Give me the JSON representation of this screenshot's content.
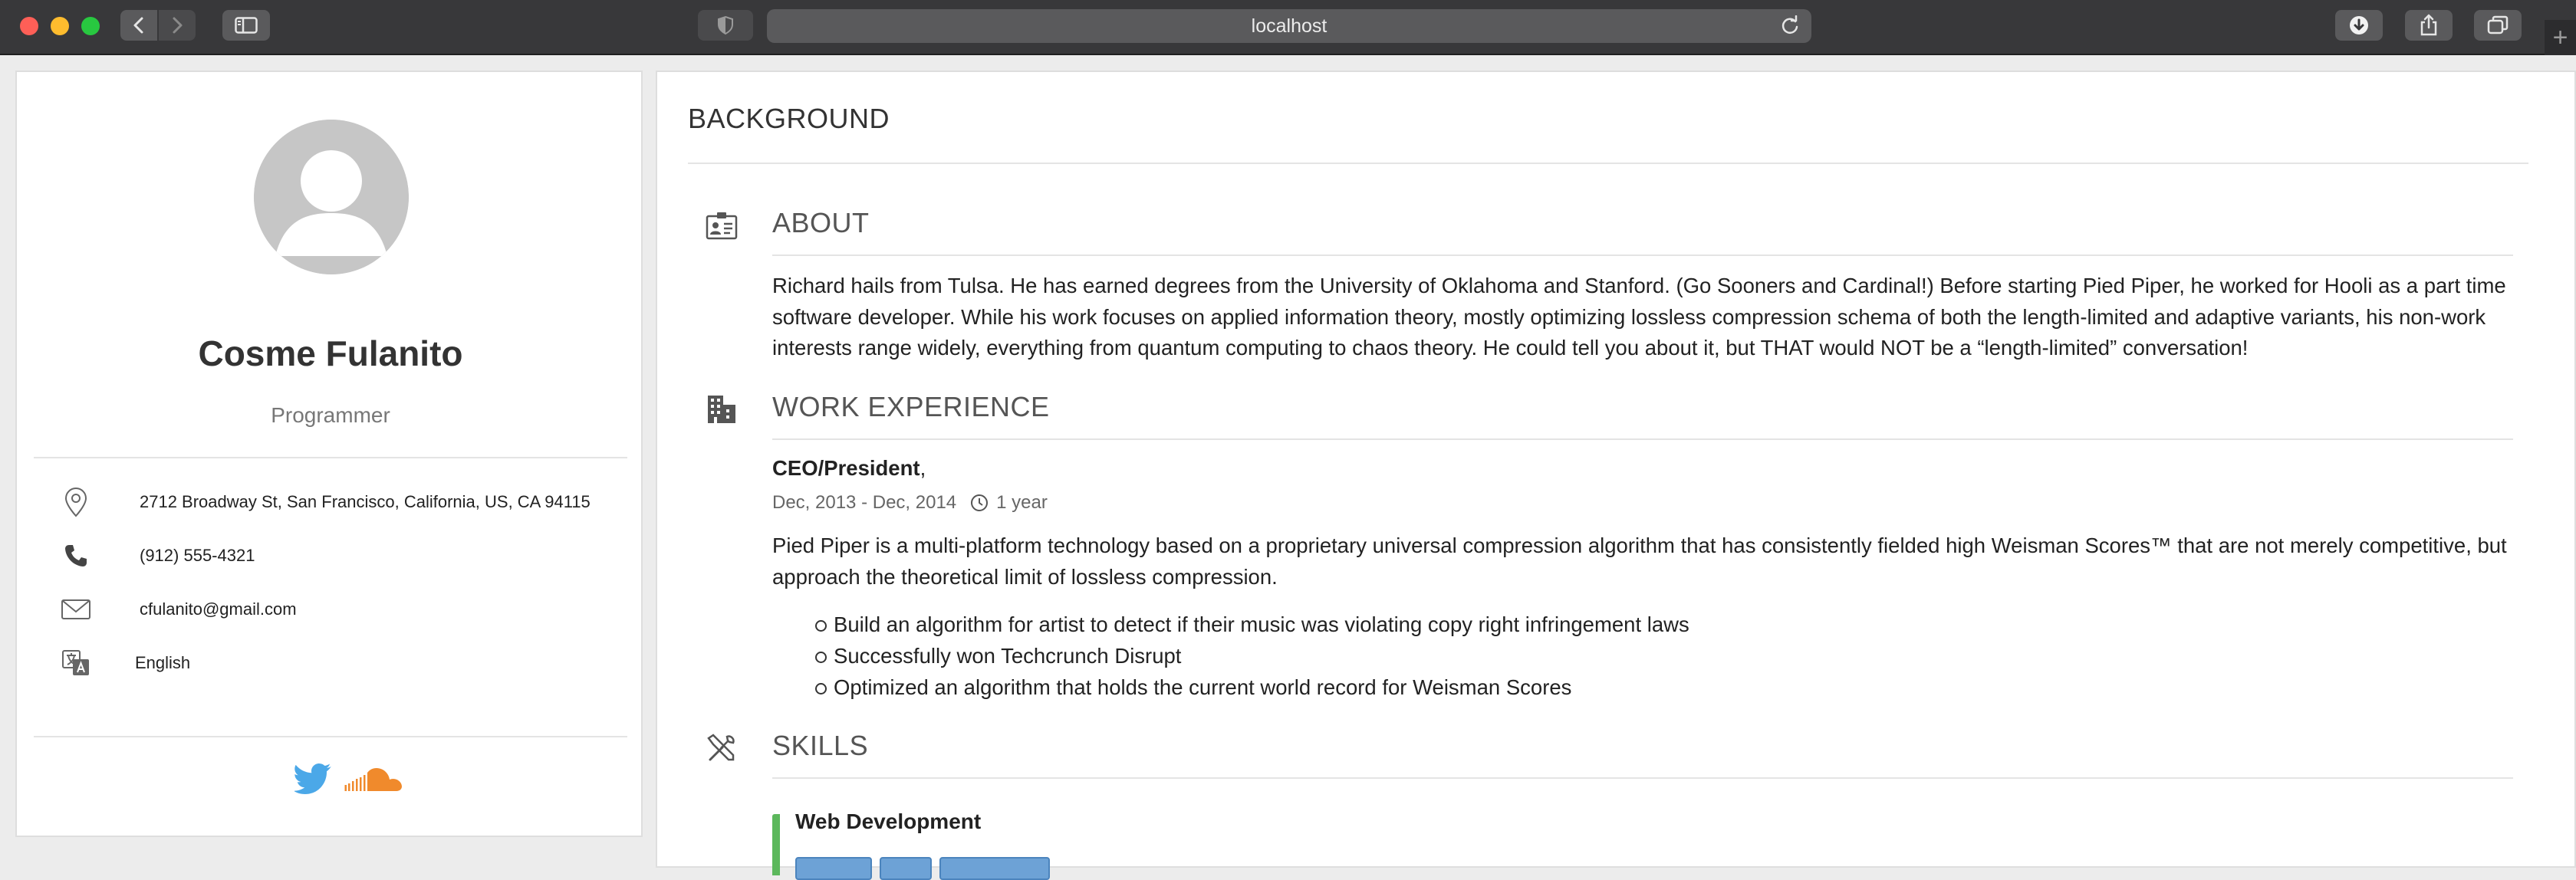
{
  "browser": {
    "url": "localhost"
  },
  "profile": {
    "name": "Cosme Fulanito",
    "role": "Programmer",
    "address": "2712 Broadway St, San Francisco, California, US, CA 94115",
    "phone": "(912) 555-4321",
    "email": "cfulanito@gmail.com",
    "language": "English",
    "social": [
      "twitter-icon",
      "soundcloud-icon"
    ]
  },
  "main": {
    "title": "BACKGROUND",
    "about": {
      "heading": "ABOUT",
      "text": "Richard hails from Tulsa. He has earned degrees from the University of Oklahoma and Stanford. (Go Sooners and Cardinal!) Before starting Pied Piper, he worked for Hooli as a part time software developer. While his work focuses on applied information theory, mostly optimizing lossless compression schema of both the length-limited and adaptive variants, his non-work interests range widely, everything from quantum computing to chaos theory. He could tell you about it, but THAT would NOT be a “length-limited” conversation!"
    },
    "work": {
      "heading": "WORK EXPERIENCE",
      "job_title": "CEO/President",
      "job_title_suffix": ",",
      "dates": "Dec, 2013 - Dec, 2014",
      "duration": "1 year",
      "description": "Pied Piper is a multi-platform technology based on a proprietary universal compression algorithm that has consistently fielded high Weisman Scores™ that are not merely competitive, but approach the theoretical limit of lossless compression.",
      "highlights": [
        "Build an algorithm for artist to detect if their music was violating copy right infringement laws",
        "Successfully won Techcrunch Disrupt",
        "Optimized an algorithm that holds the current world record for Weisman Scores"
      ]
    },
    "skills": {
      "heading": "SKILLS",
      "group": "Web Development",
      "accent": "#5cb85c",
      "chip_color": "#6da2d6"
    }
  }
}
